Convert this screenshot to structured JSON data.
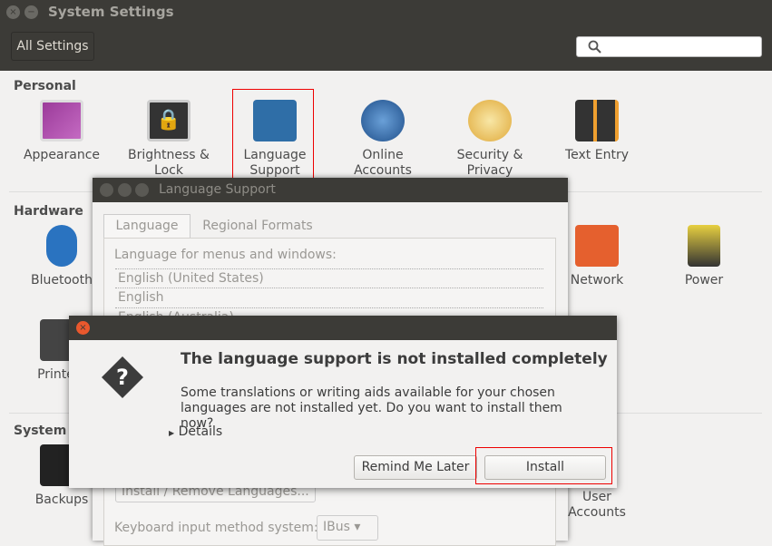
{
  "window": {
    "title": "System Settings",
    "close_icon": "×",
    "minimize_icon": "−"
  },
  "toolbar": {
    "all_settings": "All Settings",
    "search_placeholder": ""
  },
  "sections": {
    "personal": "Personal",
    "hardware": "Hardware",
    "system": "System"
  },
  "personal": [
    {
      "label": "Appearance"
    },
    {
      "label": "Brightness &\nLock"
    },
    {
      "label": "Language\nSupport"
    },
    {
      "label": "Online\nAccounts"
    },
    {
      "label": "Security &\nPrivacy"
    },
    {
      "label": "Text Entry"
    }
  ],
  "hardware": [
    {
      "label": "Bluetooth"
    },
    {
      "label": "Printers"
    },
    {
      "label": "Network"
    },
    {
      "label": "Power"
    }
  ],
  "system": [
    {
      "label": "Backups"
    },
    {
      "label": "User\nAccounts"
    }
  ],
  "language_support": {
    "title": "Language Support",
    "tabs": [
      "Language",
      "Regional Formats"
    ],
    "menus_label": "Language for menus and windows:",
    "languages": [
      "English (United States)",
      "English",
      "English (Australia)"
    ],
    "install_remove": "Install / Remove Languages...",
    "keyboard_label": "Keyboard input method system:",
    "keyboard_value": "IBus"
  },
  "alert": {
    "title": "The language support is not installed completely",
    "body": "Some translations or writing aids available for your chosen languages are not installed yet. Do you want to install them now?",
    "details": "Details",
    "remind": "Remind Me Later",
    "install": "Install"
  }
}
